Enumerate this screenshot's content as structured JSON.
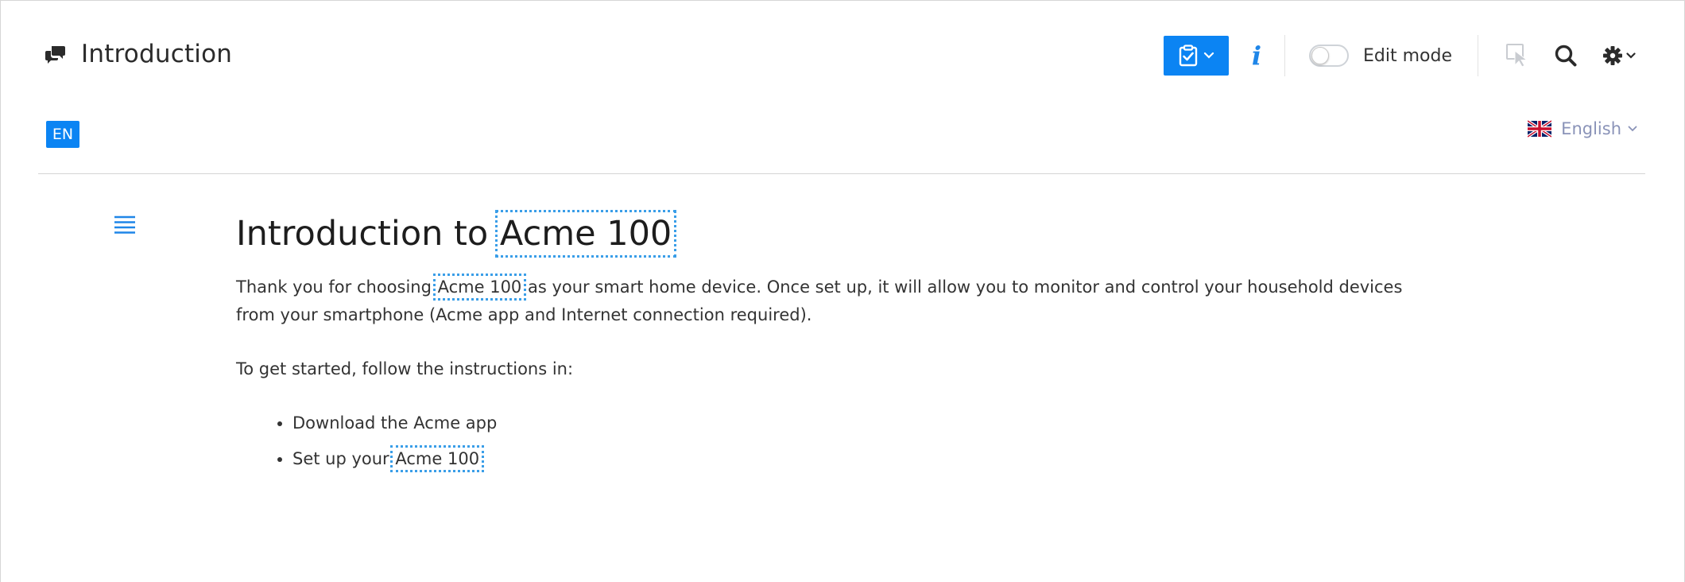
{
  "header": {
    "title": "Introduction",
    "edit_mode_label": "Edit mode",
    "info_glyph": "i"
  },
  "language": {
    "badge": "EN",
    "selected": "English"
  },
  "article": {
    "heading_prefix": "Introduction to ",
    "product_name": "Acme 100",
    "para1_before": "Thank you for choosing ",
    "para1_after": " as your smart home device. Once set up, it will allow you to monitor and control your household devices from your smartphone (Acme app and Internet connection required).",
    "para2": "To get started, follow the instructions in:",
    "bullets": [
      {
        "text": "Download the Acme app"
      },
      {
        "text_before": "Set up your ",
        "product": "Acme 100"
      }
    ]
  },
  "icons": {
    "title_icon": "chat-bubbles-icon",
    "tasks_icon": "clipboard-check-icon",
    "info_icon": "info-icon",
    "pointer_icon": "cursor-pointer-icon",
    "search_icon": "search-icon",
    "settings_icon": "gear-icon",
    "toc_icon": "list-lines-icon",
    "flag_icon": "uk-flag-icon"
  },
  "colors": {
    "accent": "#0b84f3",
    "variable_outline": "#3a9ee8",
    "language_text": "#8a93b8"
  },
  "edit_mode_on": false
}
